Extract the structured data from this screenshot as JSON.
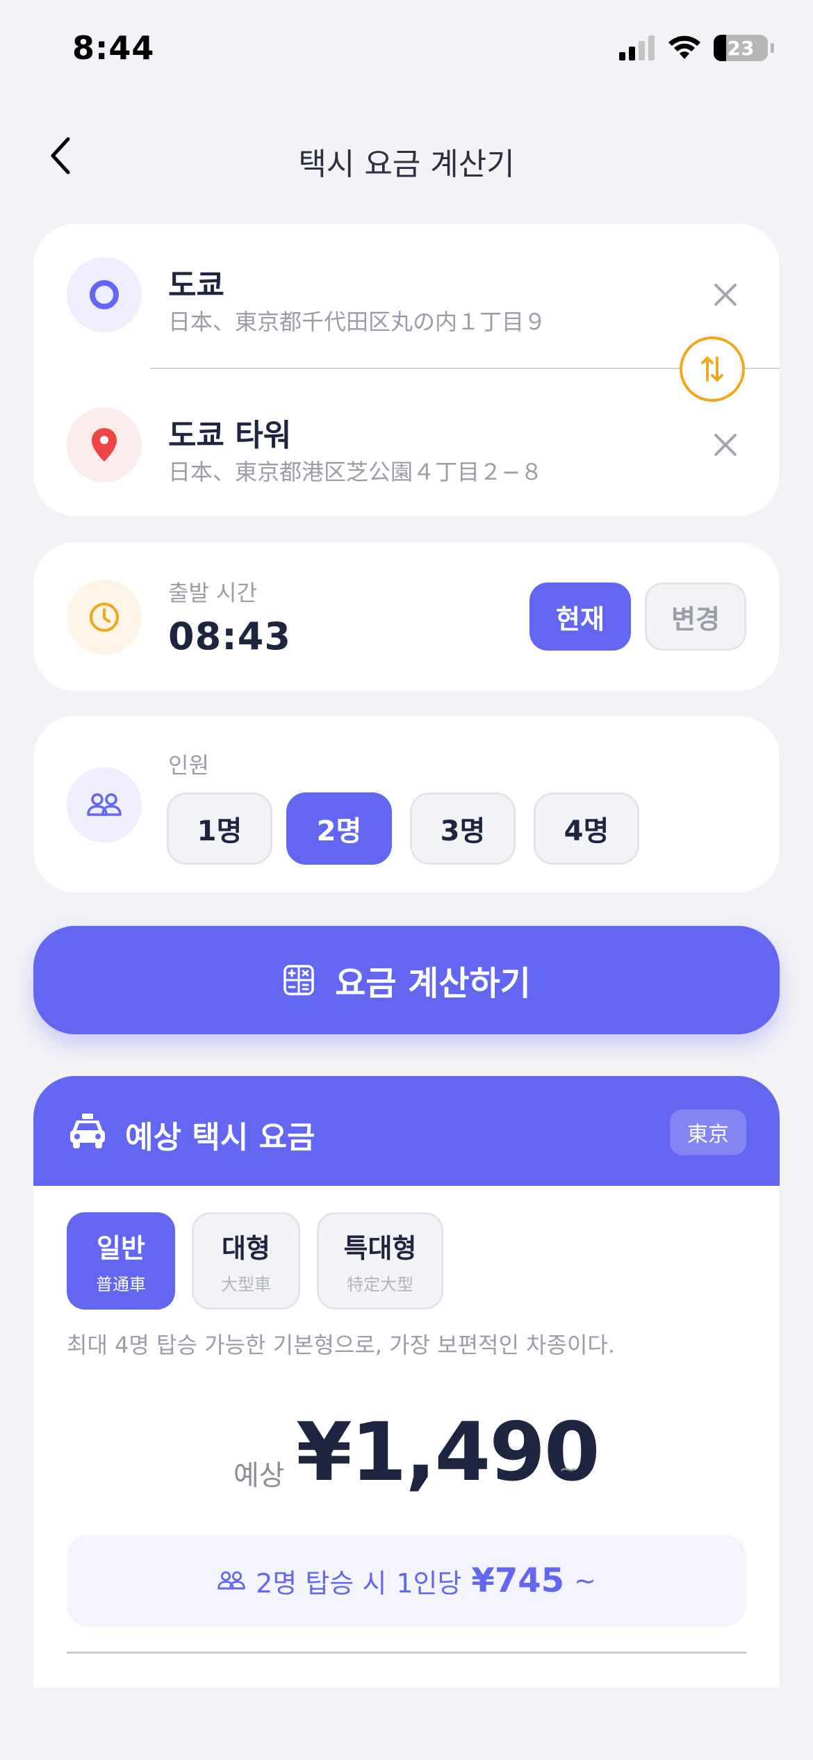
{
  "status_bar": {
    "time": "8:44",
    "battery": "23"
  },
  "header": {
    "title": "택시 요금 계산기"
  },
  "route": {
    "origin": {
      "name": "도쿄",
      "address": "日本、東京都千代田区丸の内１丁目９"
    },
    "destination": {
      "name": "도쿄 타워",
      "address": "日本、東京都港区芝公園４丁目２−８"
    }
  },
  "departure": {
    "label": "출발 시간",
    "time": "08:43",
    "now_label": "현재",
    "change_label": "변경"
  },
  "passengers": {
    "label": "인원",
    "options": [
      "1명",
      "2명",
      "3명",
      "4명"
    ],
    "selected_index": 1
  },
  "calculate_button": {
    "label": "요금 계산하기"
  },
  "result": {
    "title": "예상 택시 요금",
    "region": "東京",
    "vehicle_types": [
      {
        "label": "일반",
        "sub": "普通車"
      },
      {
        "label": "대형",
        "sub": "大型車"
      },
      {
        "label": "특대형",
        "sub": "特定大型"
      }
    ],
    "selected_type_index": 0,
    "description": "최대 4명 탑승 가능한 기본형으로, 가장 보편적인 차종이다.",
    "fare_prefix": "예상",
    "fare_amount": "¥1,490",
    "fare_suffix": "~",
    "per_person": {
      "riders_text": "2명 탑승 시",
      "per_label": "1인당",
      "amount": "¥745",
      "suffix": "~"
    }
  },
  "colors": {
    "accent": "#6366f1",
    "swap_ring": "#f2a81d",
    "pin_red": "#ef4444",
    "clock_orange": "#f2a81d",
    "background": "#f2f2f7"
  }
}
